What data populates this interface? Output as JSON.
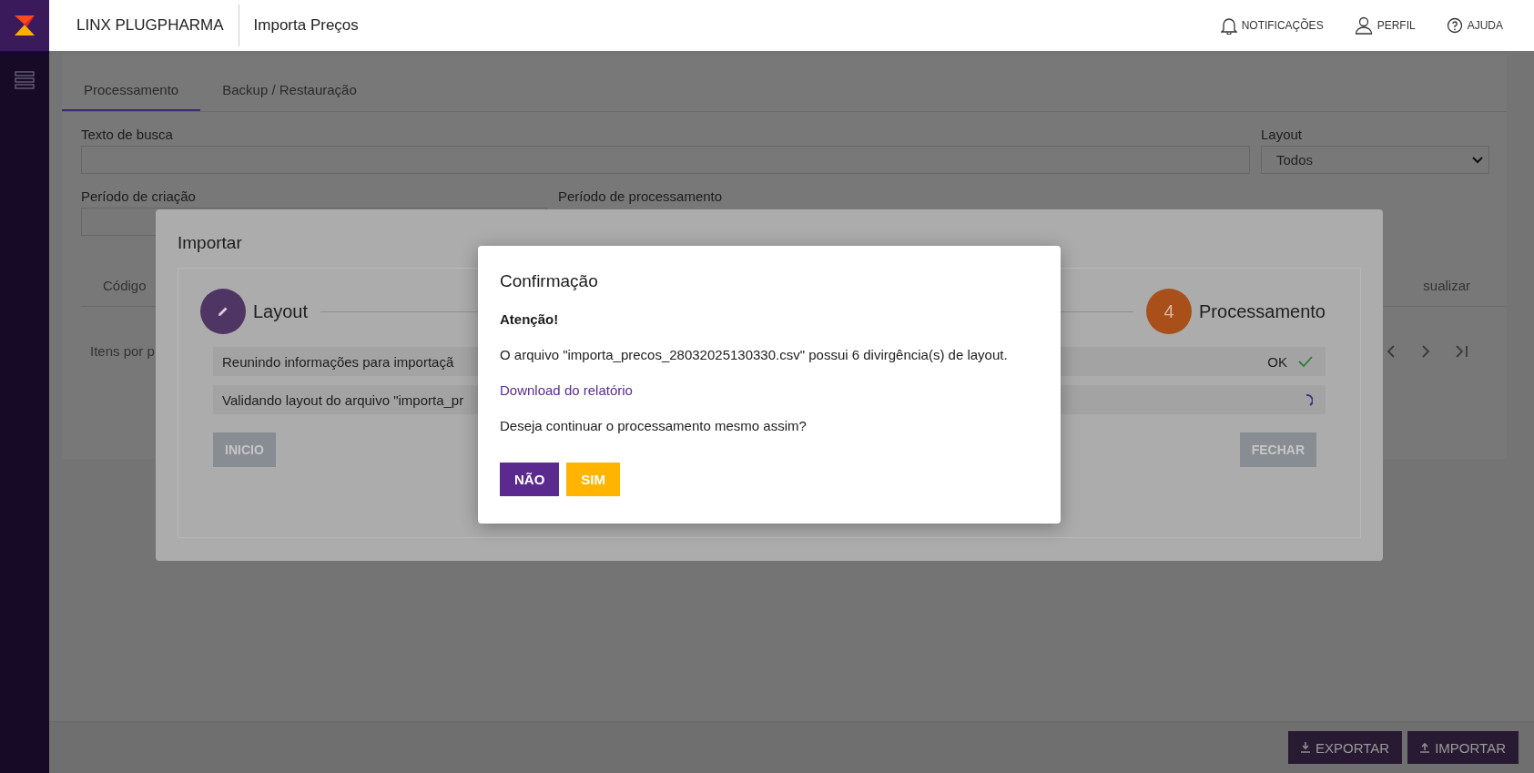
{
  "app": {
    "brand": "LINX PLUGPHARMA",
    "page_title": "Importa Preços"
  },
  "header_actions": [
    {
      "label": "NOTIFICAÇÕES",
      "kind": "bell"
    },
    {
      "label": "PERFIL",
      "kind": "user"
    },
    {
      "label": "AJUDA",
      "kind": "help"
    }
  ],
  "tabs": [
    {
      "label": "Processamento",
      "selected": true
    },
    {
      "label": "Backup / Restauração",
      "selected": false
    }
  ],
  "filters": {
    "search_label": "Texto de busca",
    "layout_label": "Layout",
    "layout_value": "Todos",
    "created_label": "Período de criação",
    "processed_label": "Período de processamento"
  },
  "table": {
    "columns": [
      "Código",
      "sualizar"
    ]
  },
  "pagination": {
    "label": "Itens por p"
  },
  "footer_buttons": [
    {
      "label": "EXPORTAR",
      "kind": "download"
    },
    {
      "label": "IMPORTAR",
      "kind": "upload"
    }
  ],
  "import_dialog": {
    "title": "Importar",
    "steps": [
      {
        "kind": "icon",
        "label": "Layout",
        "color": "#4f3563"
      },
      {
        "kind": "number",
        "number": "4",
        "label": "Processamento",
        "color": "#a84f1a"
      }
    ],
    "tasks": [
      {
        "text": "Reunindo informações para importaçã",
        "done": true,
        "status_text": "OK"
      },
      {
        "text": "Validando layout do arquivo \"importa_pr",
        "done": false
      }
    ],
    "buttons": [
      "INICIO",
      "FECHAR"
    ]
  },
  "confirm_dialog": {
    "title": "Confirmação",
    "warning": "Atenção!",
    "message": "O arquivo \"importa_precos_28032025130330.csv\" possui 6 divirgência(s) de layout.",
    "link": "Download do relatório",
    "question": "Deseja continuar o processamento mesmo assim?",
    "buttons": [
      {
        "label": "NÃO",
        "kind": "primary"
      },
      {
        "label": "SIM",
        "kind": "warning"
      }
    ]
  }
}
